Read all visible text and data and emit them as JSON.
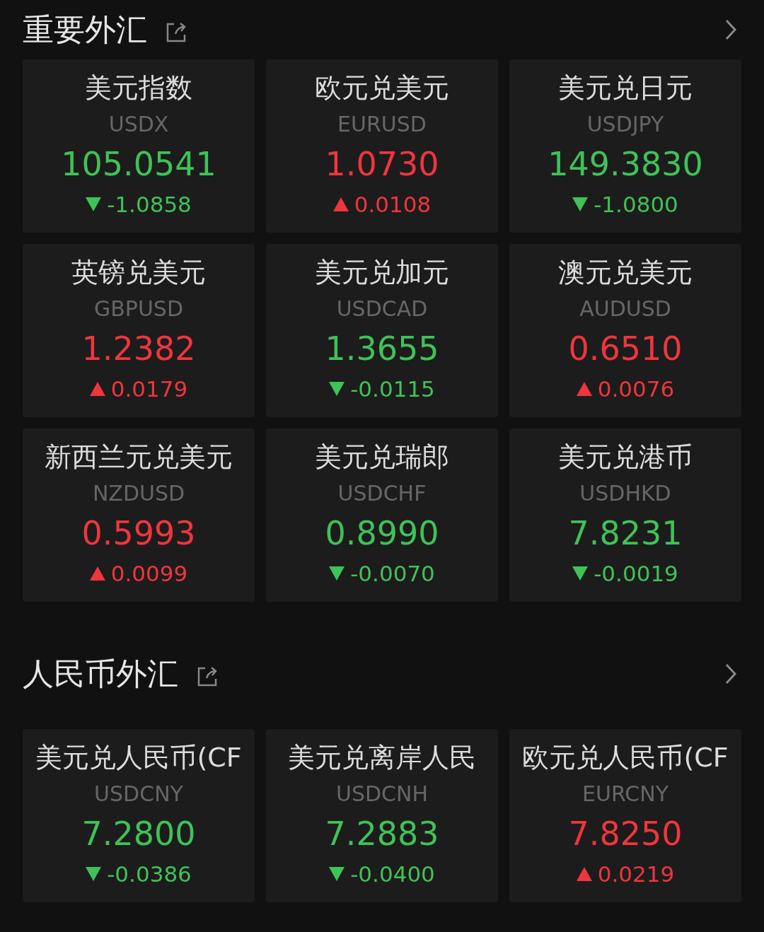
{
  "sections": [
    {
      "title": "重要外汇",
      "quotes": [
        {
          "name": "美元指数",
          "code": "USDX",
          "price": "105.0541",
          "change": "-1.0858",
          "rising": false
        },
        {
          "name": "欧元兑美元",
          "code": "EURUSD",
          "price": "1.0730",
          "change": "0.0108",
          "rising": true
        },
        {
          "name": "美元兑日元",
          "code": "USDJPY",
          "price": "149.3830",
          "change": "-1.0800",
          "rising": false
        },
        {
          "name": "英镑兑美元",
          "code": "GBPUSD",
          "price": "1.2382",
          "change": "0.0179",
          "rising": true
        },
        {
          "name": "美元兑加元",
          "code": "USDCAD",
          "price": "1.3655",
          "change": "-0.0115",
          "rising": false
        },
        {
          "name": "澳元兑美元",
          "code": "AUDUSD",
          "price": "0.6510",
          "change": "0.0076",
          "rising": true
        },
        {
          "name": "新西兰元兑美元",
          "code": "NZDUSD",
          "price": "0.5993",
          "change": "0.0099",
          "rising": true
        },
        {
          "name": "美元兑瑞郎",
          "code": "USDCHF",
          "price": "0.8990",
          "change": "-0.0070",
          "rising": false
        },
        {
          "name": "美元兑港币",
          "code": "USDHKD",
          "price": "7.8231",
          "change": "-0.0019",
          "rising": false
        }
      ]
    },
    {
      "title": "人民币外汇",
      "quotes": [
        {
          "name": "美元兑人民币(CF",
          "code": "USDCNY",
          "price": "7.2800",
          "change": "-0.0386",
          "rising": false
        },
        {
          "name": "美元兑离岸人民",
          "code": "USDCNH",
          "price": "7.2883",
          "change": "-0.0400",
          "rising": false
        },
        {
          "name": "欧元兑人民币(CF",
          "code": "EURCNY",
          "price": "7.8250",
          "change": "0.0219",
          "rising": true
        }
      ]
    }
  ]
}
